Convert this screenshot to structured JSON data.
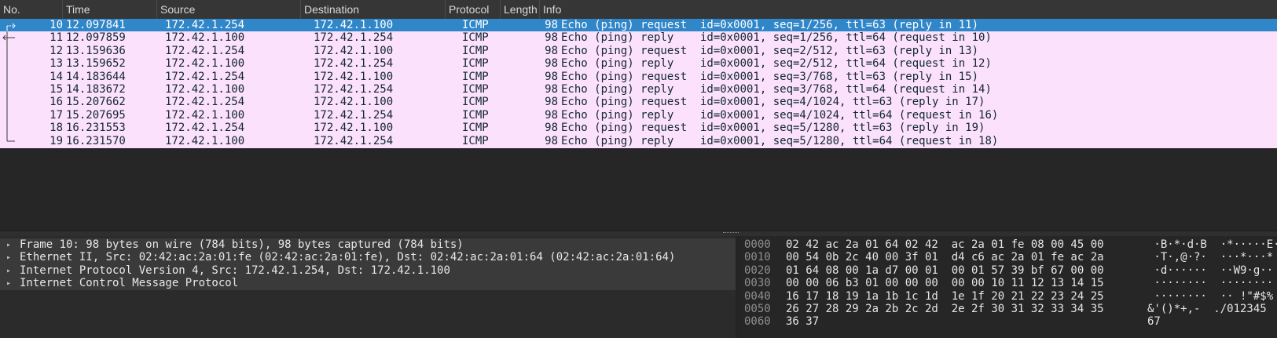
{
  "columns": [
    "No.",
    "Time",
    "Source",
    "Destination",
    "Protocol",
    "Length",
    "Info"
  ],
  "packets": [
    {
      "no": "10",
      "time": "12.097841",
      "src": "172.42.1.254",
      "dst": "172.42.1.100",
      "proto": "ICMP",
      "len": "98",
      "info": "Echo (ping) request  id=0x0001, seq=1/256, ttl=63 (reply in 11)"
    },
    {
      "no": "11",
      "time": "12.097859",
      "src": "172.42.1.100",
      "dst": "172.42.1.254",
      "proto": "ICMP",
      "len": "98",
      "info": "Echo (ping) reply    id=0x0001, seq=1/256, ttl=64 (request in 10)"
    },
    {
      "no": "12",
      "time": "13.159636",
      "src": "172.42.1.254",
      "dst": "172.42.1.100",
      "proto": "ICMP",
      "len": "98",
      "info": "Echo (ping) request  id=0x0001, seq=2/512, ttl=63 (reply in 13)"
    },
    {
      "no": "13",
      "time": "13.159652",
      "src": "172.42.1.100",
      "dst": "172.42.1.254",
      "proto": "ICMP",
      "len": "98",
      "info": "Echo (ping) reply    id=0x0001, seq=2/512, ttl=64 (request in 12)"
    },
    {
      "no": "14",
      "time": "14.183644",
      "src": "172.42.1.254",
      "dst": "172.42.1.100",
      "proto": "ICMP",
      "len": "98",
      "info": "Echo (ping) request  id=0x0001, seq=3/768, ttl=63 (reply in 15)"
    },
    {
      "no": "15",
      "time": "14.183672",
      "src": "172.42.1.100",
      "dst": "172.42.1.254",
      "proto": "ICMP",
      "len": "98",
      "info": "Echo (ping) reply    id=0x0001, seq=3/768, ttl=64 (request in 14)"
    },
    {
      "no": "16",
      "time": "15.207662",
      "src": "172.42.1.254",
      "dst": "172.42.1.100",
      "proto": "ICMP",
      "len": "98",
      "info": "Echo (ping) request  id=0x0001, seq=4/1024, ttl=63 (reply in 17)"
    },
    {
      "no": "17",
      "time": "15.207695",
      "src": "172.42.1.100",
      "dst": "172.42.1.254",
      "proto": "ICMP",
      "len": "98",
      "info": "Echo (ping) reply    id=0x0001, seq=4/1024, ttl=64 (request in 16)"
    },
    {
      "no": "18",
      "time": "16.231553",
      "src": "172.42.1.254",
      "dst": "172.42.1.100",
      "proto": "ICMP",
      "len": "98",
      "info": "Echo (ping) request  id=0x0001, seq=5/1280, ttl=63 (reply in 19)"
    },
    {
      "no": "19",
      "time": "16.231570",
      "src": "172.42.1.100",
      "dst": "172.42.1.254",
      "proto": "ICMP",
      "len": "98",
      "info": "Echo (ping) reply    id=0x0001, seq=5/1280, ttl=64 (request in 18)"
    }
  ],
  "selected_no": "10",
  "details": [
    "Frame 10: 98 bytes on wire (784 bits), 98 bytes captured (784 bits)",
    "Ethernet II, Src: 02:42:ac:2a:01:fe (02:42:ac:2a:01:fe), Dst: 02:42:ac:2a:01:64 (02:42:ac:2a:01:64)",
    "Internet Protocol Version 4, Src: 172.42.1.254, Dst: 172.42.1.100",
    "Internet Control Message Protocol"
  ],
  "bytes": [
    {
      "offset": "0000",
      "hex": "02 42 ac 2a 01 64 02 42  ac 2a 01 fe 08 00 45 00",
      "ascii": " ·B·*·d·B  ·*·····E·"
    },
    {
      "offset": "0010",
      "hex": "00 54 0b 2c 40 00 3f 01  d4 c6 ac 2a 01 fe ac 2a",
      "ascii": " ·T·,@·?·  ···*···*"
    },
    {
      "offset": "0020",
      "hex": "01 64 08 00 1a d7 00 01  00 01 57 39 bf 67 00 00",
      "ascii": " ·d······  ··W9·g··"
    },
    {
      "offset": "0030",
      "hex": "00 00 06 b3 01 00 00 00  00 00 10 11 12 13 14 15",
      "ascii": " ········  ········"
    },
    {
      "offset": "0040",
      "hex": "16 17 18 19 1a 1b 1c 1d  1e 1f 20 21 22 23 24 25",
      "ascii": " ········  ·· !\"#$%"
    },
    {
      "offset": "0050",
      "hex": "26 27 28 29 2a 2b 2c 2d  2e 2f 30 31 32 33 34 35",
      "ascii": "&'()*+,-  ./012345"
    },
    {
      "offset": "0060",
      "hex": "36 37",
      "ascii": "67"
    }
  ]
}
